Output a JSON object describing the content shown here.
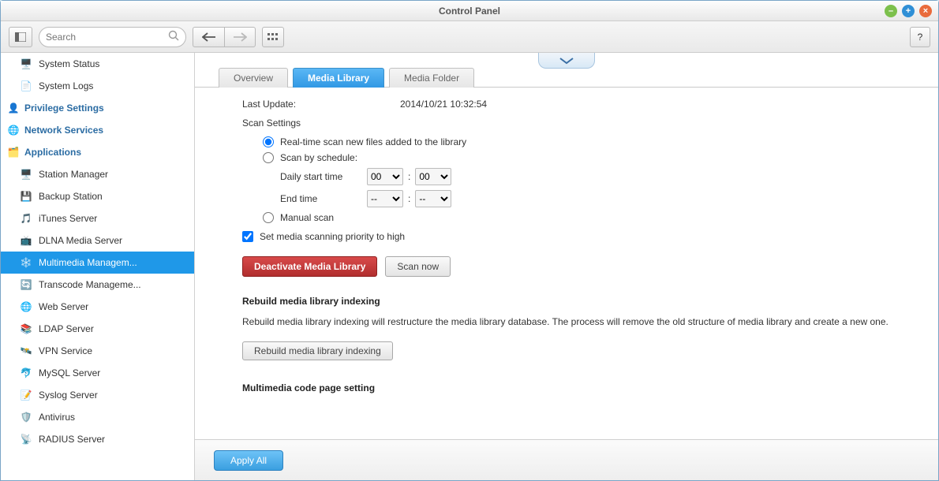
{
  "window": {
    "title": "Control Panel"
  },
  "toolbar": {
    "search_placeholder": "Search",
    "help_label": "?"
  },
  "sidebar": {
    "top_items": [
      {
        "label": "System Status",
        "icon": "🖥️"
      },
      {
        "label": "System Logs",
        "icon": "📄"
      }
    ],
    "groups": [
      {
        "label": "Privilege Settings",
        "icon": "👤",
        "items": []
      },
      {
        "label": "Network Services",
        "icon": "🌐",
        "items": []
      },
      {
        "label": "Applications",
        "icon": "🗂️",
        "items": [
          {
            "label": "Station Manager",
            "icon": "🖥️"
          },
          {
            "label": "Backup Station",
            "icon": "💾"
          },
          {
            "label": "iTunes Server",
            "icon": "🎵"
          },
          {
            "label": "DLNA Media Server",
            "icon": "📺"
          },
          {
            "label": "Multimedia Managem...",
            "icon": "❄️",
            "active": true
          },
          {
            "label": "Transcode Manageme...",
            "icon": "🔄"
          },
          {
            "label": "Web Server",
            "icon": "🌐"
          },
          {
            "label": "LDAP Server",
            "icon": "📚"
          },
          {
            "label": "VPN Service",
            "icon": "🛰️"
          },
          {
            "label": "MySQL Server",
            "icon": "🐬"
          },
          {
            "label": "Syslog Server",
            "icon": "📝"
          },
          {
            "label": "Antivirus",
            "icon": "🛡️"
          },
          {
            "label": "RADIUS Server",
            "icon": "📡"
          }
        ]
      }
    ]
  },
  "tabs": [
    {
      "label": "Overview"
    },
    {
      "label": "Media Library",
      "active": true
    },
    {
      "label": "Media Folder"
    }
  ],
  "content": {
    "last_update_label": "Last Update:",
    "last_update_value": "2014/10/21 10:32:54",
    "scan_settings_label": "Scan Settings",
    "opt_realtime": "Real-time scan new files added to the library",
    "opt_schedule": "Scan by schedule:",
    "daily_start_label": "Daily start time",
    "end_time_label": "End time",
    "hour_00": "00",
    "min_00": "00",
    "dash": "--",
    "colon": ":",
    "opt_manual": "Manual scan",
    "chk_priority": "Set media scanning priority to high",
    "btn_deactivate": "Deactivate Media Library",
    "btn_scan_now": "Scan now",
    "rebuild_head": "Rebuild media library indexing",
    "rebuild_desc": "Rebuild media library indexing will restructure the media library database. The process will remove the old structure of media library and create a new one.",
    "btn_rebuild": "Rebuild media library indexing",
    "codepage_head": "Multimedia code page setting"
  },
  "footer": {
    "apply_all": "Apply All"
  }
}
